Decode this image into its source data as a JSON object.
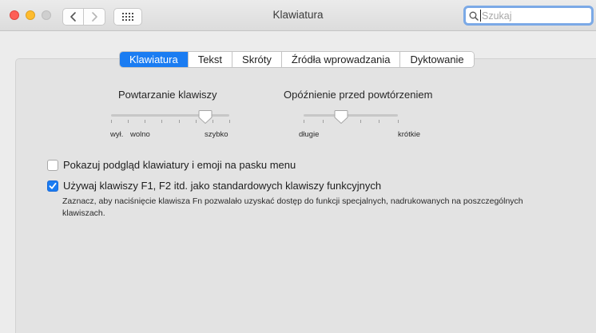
{
  "window": {
    "title": "Klawiatura"
  },
  "search": {
    "placeholder": "Szukaj",
    "value": ""
  },
  "icons": {
    "back": "chevron-left-icon",
    "forward": "chevron-right-icon",
    "grid": "grid-icon",
    "search": "magnifier-icon",
    "check": "checkmark-icon"
  },
  "tabs": [
    {
      "label": "Klawiatura",
      "active": true
    },
    {
      "label": "Tekst",
      "active": false
    },
    {
      "label": "Skróty",
      "active": false
    },
    {
      "label": "Źródła wprowadzania",
      "active": false
    },
    {
      "label": "Dyktowanie",
      "active": false
    }
  ],
  "key_repeat": {
    "title": "Powtarzanie klawiszy",
    "label_off": "wył.",
    "label_slow": "wolno",
    "label_fast": "szybko",
    "level_fraction": 0.8
  },
  "repeat_delay": {
    "title": "Opóźnienie przed powtórzeniem",
    "label_long": "długie",
    "label_short": "krótkie",
    "level_fraction": 0.4
  },
  "options": {
    "show_viewer": {
      "label": "Pokazuj podgląd klawiatury i emoji na pasku menu",
      "checked": false
    },
    "fn_keys": {
      "label": "Używaj klawiszy F1, F2 itd. jako standardowych klawiszy funkcyjnych",
      "checked": true,
      "description": "Zaznacz, aby naciśnięcie klawisza Fn pozwalało uzyskać dostęp do funkcji specjalnych, nadrukowanych na poszczególnych klawiszach."
    }
  },
  "colors": {
    "accent": "#1a7cf2",
    "close": "#fe5f57",
    "minimize": "#febc2e",
    "panel": "#e3e3e3"
  }
}
